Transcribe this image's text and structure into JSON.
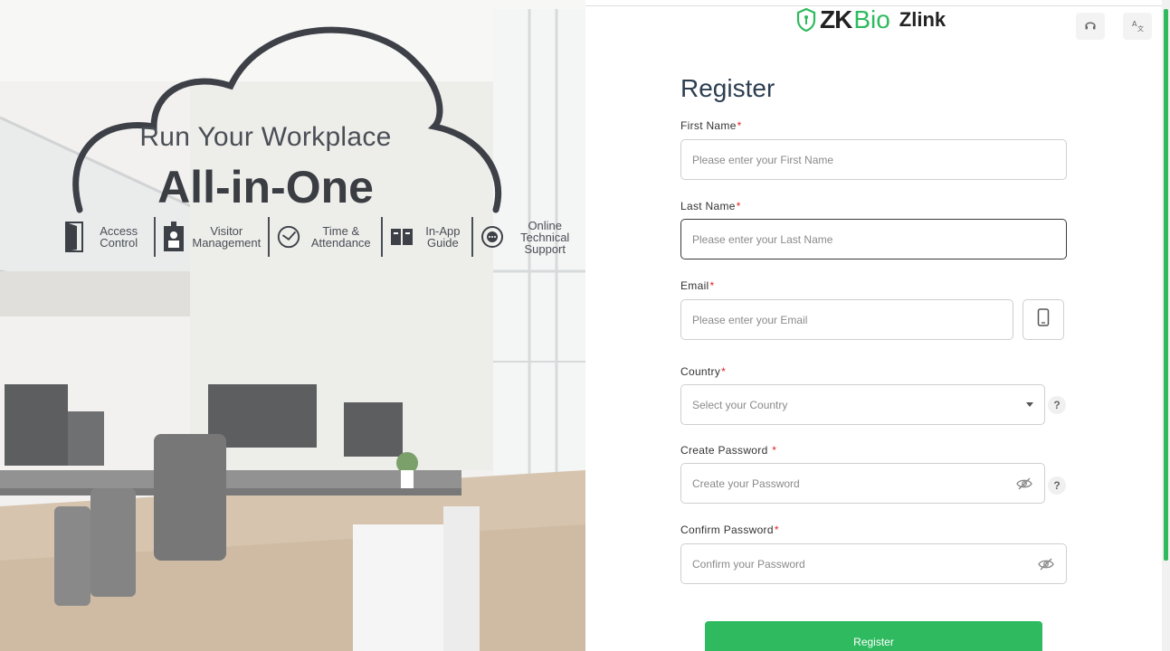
{
  "hero": {
    "tagline_line1": "Run Your Workplace",
    "tagline_line2": "All-in-One",
    "features": [
      {
        "icon": "door-icon",
        "label": "Access Control"
      },
      {
        "icon": "visitor-badge-icon",
        "label": "Visitor Management"
      },
      {
        "icon": "clock-icon",
        "label": "Time & Attendance"
      },
      {
        "icon": "book-icon",
        "label": "In-App Guide"
      },
      {
        "icon": "chat-support-icon",
        "label": "Online Technical Support"
      }
    ]
  },
  "header": {
    "logo_zk": "ZK",
    "logo_bio": "Bio",
    "logo_zlink": "Zlink",
    "support_icon": "headset-icon",
    "language_icon": "translate-icon"
  },
  "form": {
    "title": "Register",
    "required_mark": "*",
    "first_name": {
      "label": "First Name",
      "placeholder": "Please enter your First Name"
    },
    "last_name": {
      "label": "Last Name",
      "placeholder": "Please enter your Last Name"
    },
    "email": {
      "label": "Email",
      "placeholder": "Please enter your Email"
    },
    "country": {
      "label": "Country",
      "placeholder": "Select your Country"
    },
    "create_password": {
      "label": "Create Password ",
      "placeholder": "Create your Password"
    },
    "confirm_password": {
      "label": "Confirm Password",
      "placeholder": "Confirm your Password"
    },
    "help_mark": "?",
    "submit_label": "Register"
  },
  "colors": {
    "accent": "#2fba5f",
    "required": "#e02424",
    "title": "#2c3e50"
  }
}
